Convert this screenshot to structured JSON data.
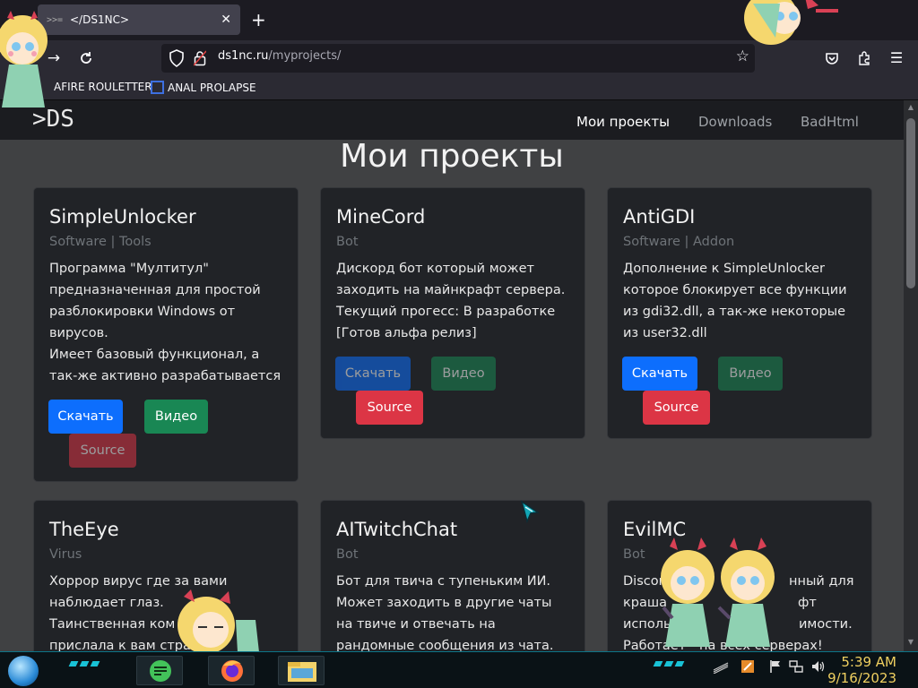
{
  "browser": {
    "tab": {
      "favicon_text": ">>=",
      "title": "</DS1NC>",
      "close": "✕"
    },
    "new_tab": "+",
    "url_host": "ds1nc.ru",
    "url_path": "/myprojects/",
    "bookmarks": [
      {
        "label": "AFIRE ROULETTER"
      },
      {
        "label": "ANAL PROLAPSE"
      }
    ]
  },
  "site": {
    "logo": ">DS",
    "nav": [
      {
        "label": "Мои проекты",
        "active": true
      },
      {
        "label": "Downloads",
        "active": false
      },
      {
        "label": "BadHtml",
        "active": false
      }
    ],
    "heading": "Мои проекты",
    "cards": [
      {
        "title": "SimpleUnlocker",
        "subtitle": "Software | Tools",
        "desc": "Программа \"Мултитул\" предназначенная для простой разблокировки Windows от вирусов.\nИмеет базовый функционал, а так-же активно разрабатывается",
        "buttons": [
          "Скачать",
          "Видео",
          "Source"
        ]
      },
      {
        "title": "MineCord",
        "subtitle": "Bot",
        "desc": "Дискорд бот который может заходить на майнкрафт сервера. Текущий прогесс: В разработке [Готов альфа релиз]",
        "buttons": [
          "Скачать",
          "Видео",
          "Source"
        ]
      },
      {
        "title": "AntiGDI",
        "subtitle": "Software | Addon",
        "desc": "Дополнение к SimpleUnlocker которое блокирует все функции из gdi32.dll, а так-же некоторые из user32.dll",
        "buttons": [
          "Скачать",
          "Видео",
          "Source"
        ]
      },
      {
        "title": "TheEye",
        "subtitle": "Virus",
        "desc": "Хоррор вирус где за вами наблюдает глаз.\nТаинственная ком",
        "desc2": "прислала к вам стра"
      },
      {
        "title": "AITwitchChat",
        "subtitle": "Bot",
        "desc": "Бот для твича с тупеньким ИИ. Может заходить в другие чаты на твиче и отвечать на рандомные сообщения из чата. Сделан по"
      },
      {
        "title": "EvilMC",
        "subtitle": "Bot",
        "line1a": "Discor",
        "line1b": "нный для",
        "line2a": "краша",
        "line2b": "фт",
        "line3a": "исполь",
        "line3b": "имости.",
        "line4a": "Работает",
        "line4b": "на всех серверах!"
      }
    ]
  },
  "taskbar": {
    "time": "5:39 AM",
    "date": "9/16/2023"
  },
  "colors": {
    "primary": "#0d6efd",
    "success": "#198754",
    "danger": "#dc3545"
  }
}
